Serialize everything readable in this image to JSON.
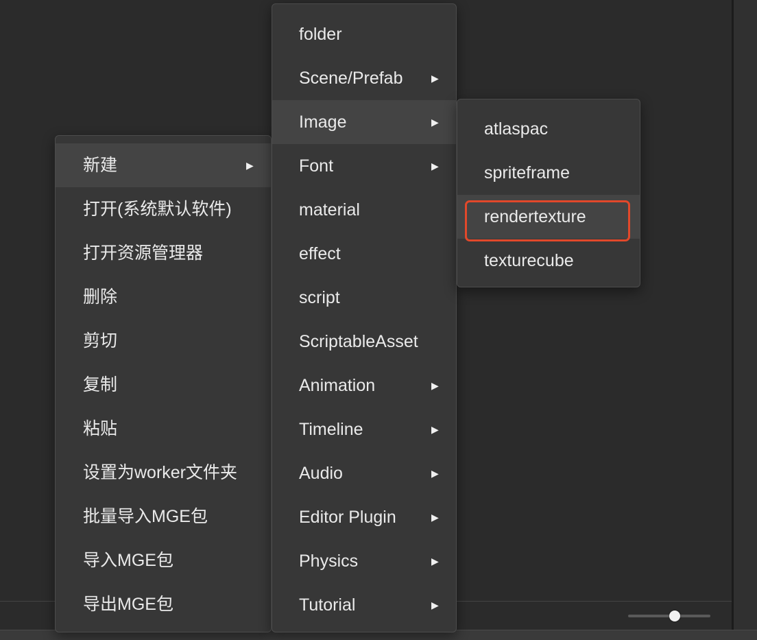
{
  "menus": {
    "main": {
      "items": [
        {
          "label": "新建",
          "submenu": true,
          "highlighted": true
        },
        {
          "label": "打开(系统默认软件)"
        },
        {
          "label": "打开资源管理器"
        },
        {
          "label": "删除"
        },
        {
          "label": "剪切"
        },
        {
          "label": "复制"
        },
        {
          "label": "粘贴"
        },
        {
          "label": "设置为worker文件夹"
        },
        {
          "label": "批量导入MGE包"
        },
        {
          "label": "导入MGE包"
        },
        {
          "label": "导出MGE包"
        }
      ]
    },
    "new": {
      "items": [
        {
          "label": "folder"
        },
        {
          "label": "Scene/Prefab",
          "submenu": true
        },
        {
          "label": "Image",
          "submenu": true,
          "highlighted": true
        },
        {
          "label": "Font",
          "submenu": true
        },
        {
          "label": "material"
        },
        {
          "label": "effect"
        },
        {
          "label": "script"
        },
        {
          "label": "ScriptableAsset"
        },
        {
          "label": "Animation",
          "submenu": true
        },
        {
          "label": "Timeline",
          "submenu": true
        },
        {
          "label": "Audio",
          "submenu": true
        },
        {
          "label": "Editor Plugin",
          "submenu": true
        },
        {
          "label": "Physics",
          "submenu": true
        },
        {
          "label": "Tutorial",
          "submenu": true
        }
      ]
    },
    "image": {
      "items": [
        {
          "label": "atlaspac"
        },
        {
          "label": "spriteframe"
        },
        {
          "label": "rendertexture",
          "highlighted": true,
          "outlined": true
        },
        {
          "label": "texturecube"
        }
      ]
    }
  },
  "submenu_arrow": "▶",
  "colors": {
    "background": "#2b2b2b",
    "menu_bg": "#373737",
    "highlight_bg": "#444444",
    "outline": "#e2482a",
    "text": "#eaeaea"
  },
  "zoom_slider": {
    "value": 0.55
  }
}
